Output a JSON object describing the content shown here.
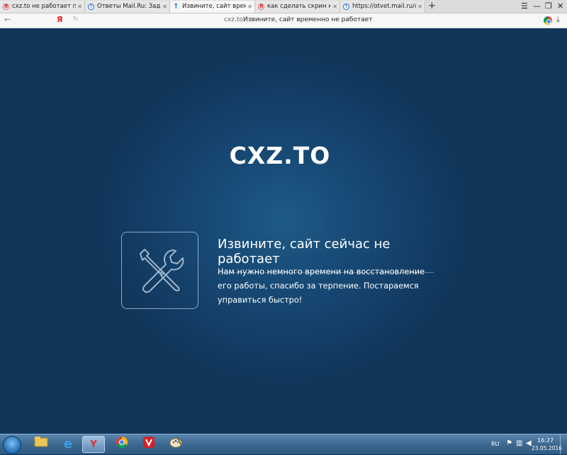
{
  "browser": {
    "tabs": [
      {
        "title": "cxz.to не работает почему –",
        "favicon": "yandex-icon",
        "active": false
      },
      {
        "title": "Ответы Mail.Ru: Задать вопр",
        "favicon": "mailru-answers-icon",
        "active": false
      },
      {
        "title": "Извините, сайт временно",
        "favicon": "upload-arrow-icon",
        "active": true
      },
      {
        "title": "как сделать скрин на комп",
        "favicon": "yandex-icon",
        "active": false
      },
      {
        "title": "https://otvet.mail.ru/question",
        "favicon": "mailru-answers-icon",
        "active": false
      }
    ],
    "new_tab": "+",
    "window_controls": {
      "menu": "☰",
      "minimize": "—",
      "restore": "❐",
      "close": "✕"
    },
    "address": {
      "back": "←",
      "home_logo": "Я",
      "reload": "↻",
      "domain": "cxz.to",
      "page_title": "Извините, сайт временно не работает"
    }
  },
  "page": {
    "logo": "CXZ.TO",
    "title": "Извините, сайт сейчас не работает",
    "body": "Нам нужно немного времени на восстановление его работы, спасибо за терпение. Постараемся управиться быстро!"
  },
  "taskbar": {
    "language": "RU",
    "time": "16:27",
    "date": "23.05.2016",
    "apps": [
      "explorer-icon",
      "internet-explorer-icon",
      "yandex-browser-icon",
      "chrome-icon",
      "vivaldi-icon",
      "paint-icon"
    ]
  },
  "colors": {
    "background": "#10365a",
    "glow": "#1f5a86",
    "outline": "#8ea6bd"
  }
}
